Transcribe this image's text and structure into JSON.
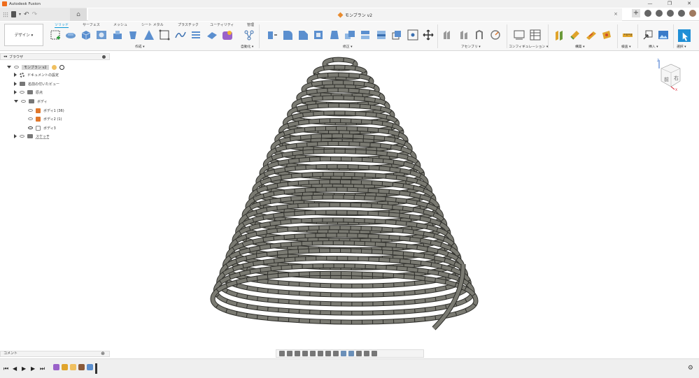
{
  "app": {
    "title": "Autodesk Fusion"
  },
  "window_controls": {
    "minimize": "—",
    "restore": "❐",
    "close": "✕"
  },
  "document": {
    "tab_title": "モンブラン v2",
    "close_icon": "×"
  },
  "quick_access": {
    "undo": "↶",
    "redo": "↷",
    "dropdown": "▾"
  },
  "ribbon": {
    "workspace": "デザイン ▾",
    "tabs": [
      "ソリッド",
      "サーフェス",
      "メッシュ",
      "シート メタル",
      "プラスチック",
      "ユーティリティ",
      "管理"
    ],
    "groups": [
      "作成 ▾",
      "自動化 ▾",
      "修正 ▾",
      "アセンブリ ▾",
      "コンフィギュレーション ▾",
      "構築 ▾",
      "検査 ▾",
      "挿入 ▾",
      "選択 ▾"
    ]
  },
  "browser": {
    "title": "ブラウザ",
    "collapse": "◂◂",
    "root": "モンブラン v2",
    "items": [
      {
        "label": "ドキュメントの設定"
      },
      {
        "label": "名前の付いたビュー"
      },
      {
        "label": "原点"
      },
      {
        "label": "ボディ"
      },
      {
        "label": "ボディ1 (36)"
      },
      {
        "label": "ボディ2 (1)"
      },
      {
        "label": "ボディ3"
      },
      {
        "label": "スケッチ"
      }
    ]
  },
  "viewcube": {
    "front": "前",
    "right": "右",
    "axis_z": "Z",
    "axis_x": "X"
  },
  "comments": {
    "label": "コメント",
    "add": "⊕"
  },
  "timeline": {
    "buttons": [
      "⏮",
      "◀",
      "▶",
      "▶",
      "⏭"
    ]
  },
  "settings_icon": "⚙",
  "colors": {
    "accent": "#0696d7",
    "body_orange": "#e0772b",
    "coil": "#7a7a72"
  }
}
